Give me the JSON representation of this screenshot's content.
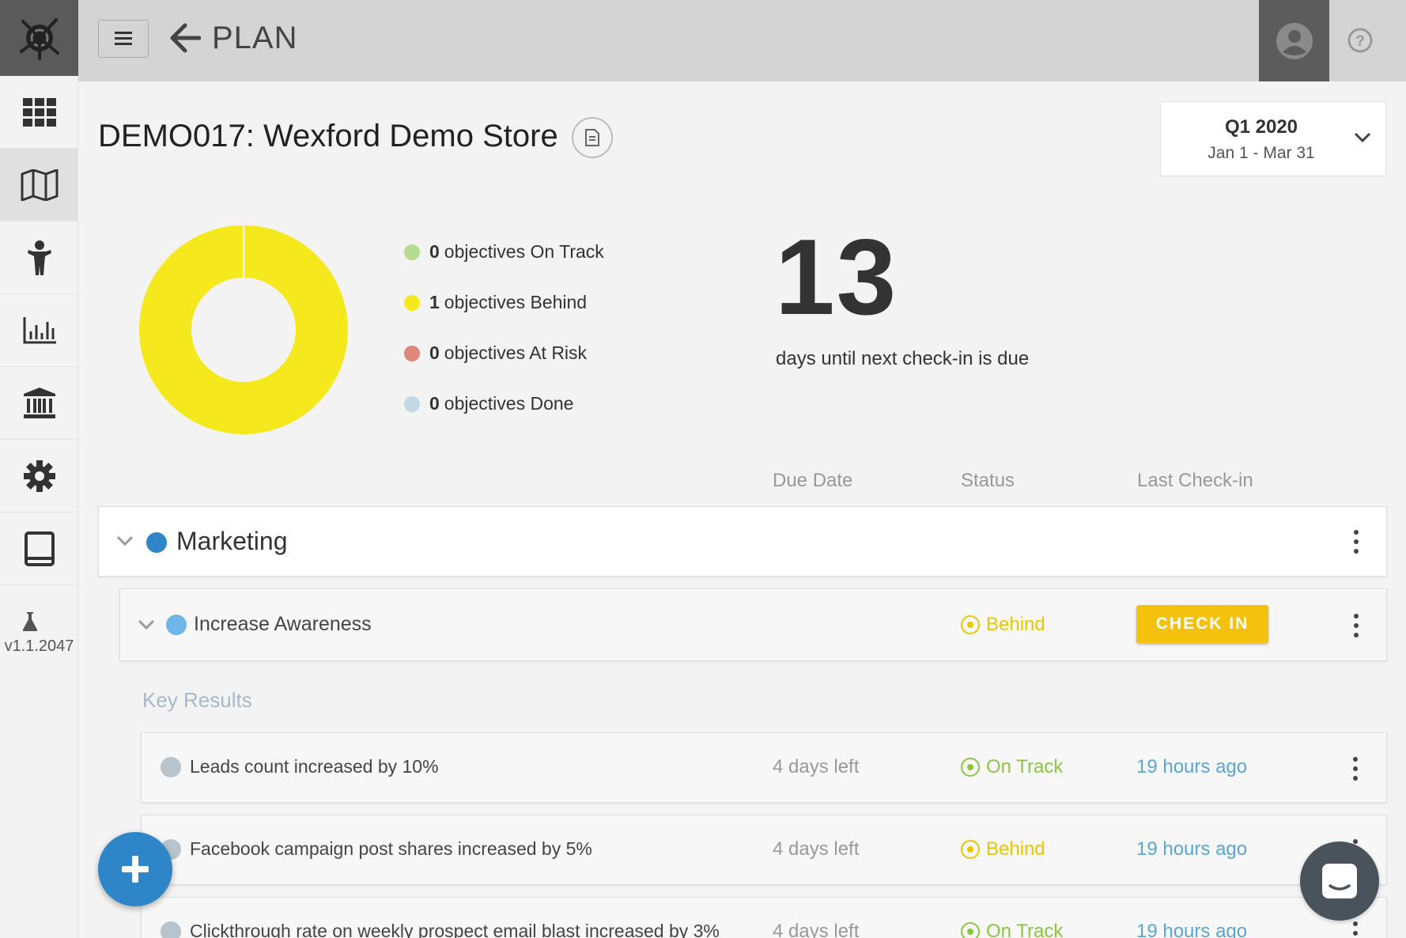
{
  "topbar": {
    "title": "PLAN"
  },
  "sidebar": {
    "items": [
      {
        "icon": "grid-icon"
      },
      {
        "icon": "map-icon"
      },
      {
        "icon": "person-icon"
      },
      {
        "icon": "bar-chart-icon"
      },
      {
        "icon": "bank-icon"
      },
      {
        "icon": "gear-icon"
      },
      {
        "icon": "tablet-icon"
      }
    ],
    "version": "v1.1.2047"
  },
  "header": {
    "store_title": "DEMO017: Wexford Demo Store",
    "period": {
      "quarter": "Q1 2020",
      "range": "Jan 1 - Mar 31"
    }
  },
  "summary": {
    "legend": [
      {
        "count": "0",
        "label": "objectives On Track",
        "color": "#b7dc8f"
      },
      {
        "count": "1",
        "label": "objectives Behind",
        "color": "#f5e81d"
      },
      {
        "count": "0",
        "label": "objectives At Risk",
        "color": "#e0877a"
      },
      {
        "count": "0",
        "label": "objectives Done",
        "color": "#c3d8e4"
      }
    ],
    "days_number": "13",
    "days_label": "days until next check-in is due"
  },
  "columns": {
    "due_date": "Due Date",
    "status": "Status",
    "last_checkin": "Last Check-in"
  },
  "group": {
    "name": "Marketing",
    "color": "#2e86c9"
  },
  "objective": {
    "name": "Increase Awareness",
    "status": "Behind",
    "checkin_label": "CHECK IN",
    "color": "#6fb7e8"
  },
  "key_results_heading": "Key Results",
  "key_results": [
    {
      "name": "Leads count increased by 10%",
      "due": "4 days left",
      "status": "On Track",
      "last": "19 hours ago"
    },
    {
      "name": "Facebook campaign post shares increased by 5%",
      "due": "4 days left",
      "status": "Behind",
      "last": "19 hours ago"
    },
    {
      "name": "Clickthrough rate on weekly prospect email blast increased by 3%",
      "due": "4 days left",
      "status": "On Track",
      "last": "19 hours ago"
    }
  ],
  "colors": {
    "behind": "#e8c700",
    "on_track": "#8cc63f",
    "link": "#5aa6d6",
    "accent": "#f4c20d",
    "fab": "#2e86c9"
  },
  "chart_data": {
    "type": "pie",
    "categories": [
      "On Track",
      "Behind",
      "At Risk",
      "Done"
    ],
    "values": [
      0,
      1,
      0,
      0
    ]
  }
}
